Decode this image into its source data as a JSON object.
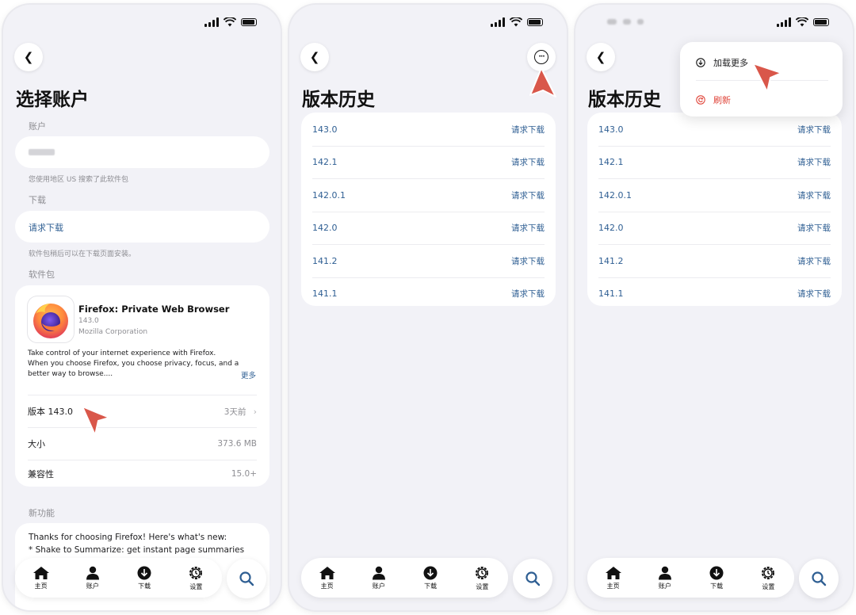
{
  "colors": {
    "link": "#2f5f93",
    "pointer": "#d9574a",
    "danger": "#e0453a",
    "muted": "#8e8e93"
  },
  "phone1": {
    "title": "选择账户",
    "account_label": "账户",
    "region_note": "您使用地区 US 搜索了此软件包",
    "download_label": "下载",
    "download_action": "请求下载",
    "download_note": "软件包稍后可以在下载页面安装。",
    "package_label": "软件包",
    "app": {
      "name": "Firefox: Private Web Browser",
      "version": "143.0",
      "developer": "Mozilla Corporation",
      "description_lines": [
        "Take control of your internet experience with Firefox.",
        "When you choose Firefox, you choose privacy, focus, and a",
        "better way to browse...."
      ],
      "more": "更多"
    },
    "rows": [
      {
        "label": "版本 143.0",
        "value": "3天前"
      },
      {
        "label": "大小",
        "value": "373.6 MB"
      },
      {
        "label": "兼容性",
        "value": "15.0+"
      }
    ],
    "whats_new_label": "新功能",
    "whats_new_lines": [
      "Thanks for choosing Firefox! Here's what's new:",
      "* Shake to Summarize: get instant page summaries"
    ]
  },
  "phone2": {
    "title": "版本历史",
    "versions": [
      {
        "version": "143.0",
        "action": "请求下载"
      },
      {
        "version": "142.1",
        "action": "请求下载"
      },
      {
        "version": "142.0.1",
        "action": "请求下载"
      },
      {
        "version": "142.0",
        "action": "请求下载"
      },
      {
        "version": "141.2",
        "action": "请求下载"
      },
      {
        "version": "141.1",
        "action": "请求下载"
      }
    ]
  },
  "phone3": {
    "title": "版本历史",
    "menu": {
      "load_more": "加载更多",
      "refresh": "刷新"
    },
    "versions": [
      {
        "version": "143.0",
        "action": "请求下载"
      },
      {
        "version": "142.1",
        "action": "请求下载"
      },
      {
        "version": "142.0.1",
        "action": "请求下载"
      },
      {
        "version": "142.0",
        "action": "请求下载"
      },
      {
        "version": "141.2",
        "action": "请求下载"
      },
      {
        "version": "141.1",
        "action": "请求下载"
      }
    ]
  },
  "tabbar": {
    "home": "主页",
    "account": "账户",
    "download": "下载",
    "settings": "设置"
  }
}
